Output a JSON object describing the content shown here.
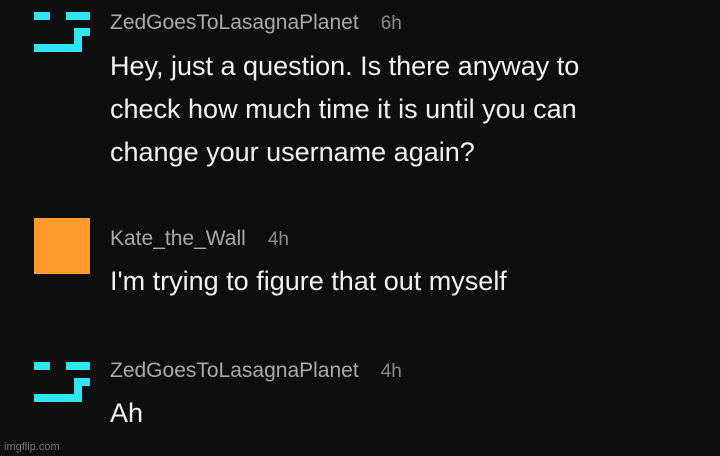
{
  "comments": [
    {
      "username": "ZedGoesToLasagnaPlanet",
      "time": "6h",
      "avatar": "pixel-face-icon",
      "avatar_color": "#2ee6f2",
      "lines": [
        "Hey, just a question. Is there anyway to",
        "check how much time it is until you can",
        "change your username again?"
      ]
    },
    {
      "username": "Kate_the_Wall",
      "time": "4h",
      "avatar": "orange-square-avatar",
      "avatar_color": "#ff9b28",
      "lines": [
        "I'm trying to figure that out myself"
      ]
    },
    {
      "username": "ZedGoesToLasagnaPlanet",
      "time": "4h",
      "avatar": "pixel-face-icon",
      "avatar_color": "#2ee6f2",
      "lines": [
        "Ah"
      ]
    }
  ],
  "watermark": "imgflip.com"
}
